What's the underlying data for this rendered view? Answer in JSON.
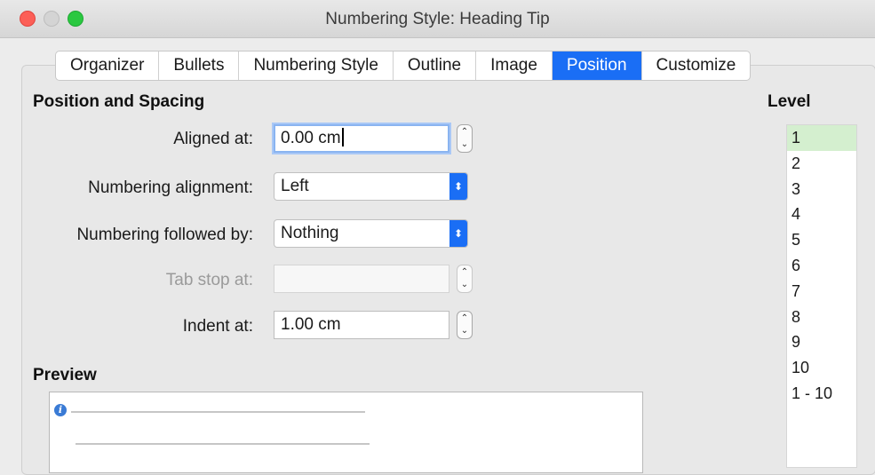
{
  "window": {
    "title": "Numbering Style: Heading Tip"
  },
  "tabs": [
    {
      "label": "Organizer",
      "active": false
    },
    {
      "label": "Bullets",
      "active": false
    },
    {
      "label": "Numbering Style",
      "active": false
    },
    {
      "label": "Outline",
      "active": false
    },
    {
      "label": "Image",
      "active": false
    },
    {
      "label": "Position",
      "active": true
    },
    {
      "label": "Customize",
      "active": false
    }
  ],
  "position_section": {
    "heading": "Position and Spacing",
    "aligned_at": {
      "label": "Aligned at:",
      "value": "0.00 cm"
    },
    "numbering_alignment": {
      "label": "Numbering alignment:",
      "value": "Left"
    },
    "numbering_followed_by": {
      "label": "Numbering followed by:",
      "value": "Nothing"
    },
    "tab_stop_at": {
      "label": "Tab stop at:",
      "value": ""
    },
    "indent_at": {
      "label": "Indent at:",
      "value": "1.00 cm"
    }
  },
  "preview": {
    "heading": "Preview"
  },
  "level": {
    "heading": "Level",
    "items": [
      "1",
      "2",
      "3",
      "4",
      "5",
      "6",
      "7",
      "8",
      "9",
      "10",
      "1 - 10"
    ],
    "selected": "1"
  },
  "colors": {
    "accent": "#1a6ef5",
    "selection": "#d4efcf"
  },
  "icons": {
    "spin": "stepper-icon",
    "select": "chevron-updown-icon",
    "info": "info-icon"
  }
}
